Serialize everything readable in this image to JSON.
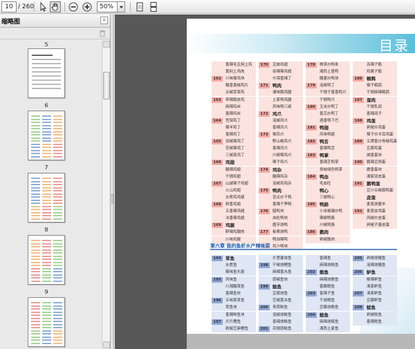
{
  "toolbar": {
    "current_page": "10",
    "total_pages": "/ 260",
    "zoom": "50%",
    "icons": [
      "select-arrow-icon",
      "hand-tool-icon",
      "zoom-out-icon",
      "zoom-in-icon",
      "single-page-icon",
      "continuous-page-icon"
    ]
  },
  "sidebar": {
    "title": "缩略图",
    "thumbnails": [
      {
        "label": "5",
        "style": "text"
      },
      {
        "label": "6",
        "style": "toc"
      },
      {
        "label": "7",
        "style": "toc"
      },
      {
        "label": "8",
        "style": "toc"
      },
      {
        "label": "9",
        "style": "toc"
      }
    ]
  },
  "document": {
    "page_title": "目录",
    "section_title": "第六章 我的鱼虾水产辣味菜"
  },
  "toc_upper": {
    "col1": [
      {
        "n": "",
        "t": "香辣毛豆焖土鸡",
        "h": false
      },
      {
        "n": "",
        "t": "黄焖土鸡肉",
        "h": false
      },
      {
        "n": "162",
        "t": "川味辣鸡块",
        "h": false
      },
      {
        "n": "",
        "t": "酸香黄椒鸡片",
        "h": false
      },
      {
        "n": "",
        "t": "尖椒芽菜鸡",
        "h": false
      },
      {
        "n": "163",
        "t": "带辣鹅皮鸡",
        "h": false
      },
      {
        "n": "",
        "t": "麻辣鸡丝",
        "h": false
      },
      {
        "n": "",
        "t": "香辣鸡丝",
        "h": false
      },
      {
        "n": "164",
        "t": "宫保鸡丁",
        "h": false
      },
      {
        "n": "",
        "t": "辣羊鸡丁",
        "h": false
      },
      {
        "n": "",
        "t": "香辣鸡丁",
        "h": false
      },
      {
        "n": "165",
        "t": "双椒辣鸡丁",
        "h": false
      },
      {
        "n": "",
        "t": "花椒辣鸡丁",
        "h": false
      },
      {
        "n": "",
        "t": "三椒蒸鸡丁",
        "h": false
      },
      {
        "n": "166",
        "t": "鸡翅",
        "h": true
      },
      {
        "n": "",
        "t": "酸辣鸡翅",
        "h": false
      },
      {
        "n": "",
        "t": "干锅鸡翅",
        "h": false
      },
      {
        "n": "167",
        "t": "山城辣子鸡翅",
        "h": false
      },
      {
        "n": "",
        "t": "火山鸡翅",
        "h": false
      },
      {
        "n": "",
        "t": "水煮鸡鸡翅",
        "h": false
      },
      {
        "n": "168",
        "t": "剁香鸡翅",
        "h": false
      },
      {
        "n": "",
        "t": "五香辣鸡翅",
        "h": false
      },
      {
        "n": "",
        "t": "冰香辣鸡翅",
        "h": false
      },
      {
        "n": "169",
        "t": "鸡腿",
        "h": true
      },
      {
        "n": "",
        "t": "醉辣鸡腿肉",
        "h": false
      },
      {
        "n": "",
        "t": "川味鸡腿",
        "h": false
      }
    ],
    "col2": [
      {
        "n": "170",
        "t": "豆豉鸡翅",
        "h": false
      },
      {
        "n": "",
        "t": "劲辣辣鸡翅",
        "h": false
      },
      {
        "n": "",
        "t": "什锦香辣丁",
        "h": false
      },
      {
        "n": "171",
        "t": "鸭肉",
        "h": true
      },
      {
        "n": "",
        "t": "湘味鹅鸡腿",
        "h": false
      },
      {
        "n": "",
        "t": "土家鸭鸡腿",
        "h": false
      },
      {
        "n": "",
        "t": "风味鸭三碗",
        "h": false
      },
      {
        "n": "172",
        "t": "鸡爪",
        "h": true
      },
      {
        "n": "",
        "t": "泡椒凤爪",
        "h": false
      },
      {
        "n": "",
        "t": "香辣凤爪",
        "h": false
      },
      {
        "n": "173",
        "t": "辣凤爪",
        "h": false
      },
      {
        "n": "",
        "t": "野山椒凤爪",
        "h": false
      },
      {
        "n": "",
        "t": "香辣凤爪",
        "h": false
      },
      {
        "n": "",
        "t": "川椒辣鸡爪",
        "h": false
      },
      {
        "n": "",
        "t": "辣子鸡爪",
        "h": false
      },
      {
        "n": "174",
        "t": "鸡杂",
        "h": true
      },
      {
        "n": "",
        "t": "酸辣鸡杂",
        "h": false
      },
      {
        "n": "",
        "t": "泡椒鸡鸡杂",
        "h": false
      },
      {
        "n": "175",
        "t": "鸭肉",
        "h": true
      },
      {
        "n": "",
        "t": "苦瓜炒干鸭",
        "h": false
      },
      {
        "n": "",
        "t": "香辣干笋鸭",
        "h": false
      },
      {
        "n": "176",
        "t": "腊鸭块",
        "h": false
      },
      {
        "n": "",
        "t": "血粒鸭块",
        "h": false
      },
      {
        "n": "",
        "t": "魔芋烧鸭",
        "h": false
      },
      {
        "n": "177",
        "t": "板栗烧鸭",
        "h": false
      },
      {
        "n": "",
        "t": "鸭油辣鸭",
        "h": false
      },
      {
        "n": "",
        "t": "鸡汁鸭块",
        "h": false
      }
    ],
    "col3": [
      {
        "n": "178",
        "t": "樟茶炒鸭条",
        "h": false
      },
      {
        "n": "",
        "t": "湘西土匪鸭",
        "h": false
      },
      {
        "n": "",
        "t": "酸姜炒鸭块",
        "h": false
      },
      {
        "n": "179",
        "t": "泡椒鸭丁",
        "h": false
      },
      {
        "n": "",
        "t": "干锅子香香鸭爪",
        "h": false
      },
      {
        "n": "",
        "t": "干锅鸭爪",
        "h": false
      },
      {
        "n": "180",
        "t": "玉米炒鸭丁",
        "h": false
      },
      {
        "n": "",
        "t": "香芯炒鸭丁",
        "h": false
      },
      {
        "n": "",
        "t": "酒香鸭下巴",
        "h": false
      },
      {
        "n": "181",
        "t": "鸭翅",
        "h": true
      },
      {
        "n": "",
        "t": "风味鸭翅",
        "h": false
      },
      {
        "n": "182",
        "t": "鸭舌",
        "h": true
      },
      {
        "n": "",
        "t": "香辣鸭舌",
        "h": false
      },
      {
        "n": "183",
        "t": "鸭掌",
        "h": true
      },
      {
        "n": "",
        "t": "香辣芝鸭掌",
        "h": false
      },
      {
        "n": "",
        "t": "青蛙绿色鸭掌",
        "h": false
      },
      {
        "n": "184",
        "t": "鸭血",
        "h": true
      },
      {
        "n": "",
        "t": "毛血旺",
        "h": false
      },
      {
        "n": "",
        "t": "鸭心",
        "h": true
      },
      {
        "n": "",
        "t": "三椒鸭心",
        "h": false
      },
      {
        "n": "185",
        "t": "鸭肠",
        "h": true
      },
      {
        "n": "",
        "t": "小米椒爆炒鸭",
        "h": false
      },
      {
        "n": "",
        "t": "辣椒鸭肠",
        "h": false
      },
      {
        "n": "",
        "t": "川椒鸭肠",
        "h": false
      },
      {
        "n": "186",
        "t": "鹅肉",
        "h": true
      },
      {
        "n": "",
        "t": "剁椒鹅肉",
        "h": false
      }
    ],
    "col4": [
      {
        "n": "",
        "t": "苏辣子鹅",
        "h": false
      },
      {
        "n": "",
        "t": "鸡翼子鹅",
        "h": false
      },
      {
        "n": "186",
        "t": "鹌鹑",
        "h": true
      },
      {
        "n": "",
        "t": "辣子鹌鹑",
        "h": false
      },
      {
        "n": "",
        "t": "干焗麻辣鹌鹑",
        "h": false
      },
      {
        "n": "187",
        "t": "蛋肉",
        "h": true
      },
      {
        "n": "",
        "t": "干锅乳鸽",
        "h": false
      },
      {
        "n": "",
        "t": "香辣鸽子",
        "h": false
      },
      {
        "n": "188",
        "t": "鸡蛋",
        "h": true
      },
      {
        "n": "",
        "t": "剁椒炒鸡蛋",
        "h": false
      },
      {
        "n": "",
        "t": "辣子炒木耳鸡蛋",
        "h": false
      },
      {
        "n": "189",
        "t": "五牌香炒青椒鸡蛋",
        "h": false
      },
      {
        "n": "",
        "t": "豆腐鸡蛋",
        "h": false
      },
      {
        "n": "",
        "t": "城香蛋块",
        "h": false
      },
      {
        "n": "190",
        "t": "鹅辣豆饧蛋",
        "h": false
      },
      {
        "n": "",
        "t": "鹿香蛋块",
        "h": false
      },
      {
        "n": "",
        "t": "湘家双皮蛋",
        "h": false
      },
      {
        "n": "191",
        "t": "鹅鸭蛋",
        "h": true
      },
      {
        "n": "",
        "t": "豆汁尖椒鹅鸭蛋",
        "h": false
      },
      {
        "n": "",
        "t": "皮蛋",
        "h": true
      },
      {
        "n": "",
        "t": "麦蒸烧魔羊",
        "h": false
      },
      {
        "n": "192",
        "t": "麦蒸皮鸡蛋",
        "h": false
      },
      {
        "n": "",
        "t": "风椒炒皮蛋",
        "h": false
      },
      {
        "n": "",
        "t": "剁椒子姜皮蛋",
        "h": false
      }
    ]
  },
  "toc_lower": {
    "col1": [
      {
        "n": "194",
        "t": "草鱼",
        "h": true
      },
      {
        "n": "",
        "t": "水煮鱼",
        "h": false
      },
      {
        "n": "",
        "t": "辣味鱼头尾",
        "h": false
      },
      {
        "n": "195",
        "t": "风味鱼",
        "h": false
      },
      {
        "n": "",
        "t": "川湘酸菜鱼",
        "h": false
      },
      {
        "n": "",
        "t": "香辣鱼块",
        "h": false
      },
      {
        "n": "196",
        "t": "五味蒸草鱼",
        "h": false
      },
      {
        "n": "",
        "t": "草鱼块",
        "h": false
      },
      {
        "n": "",
        "t": "香辣鲜鱼块",
        "h": false
      },
      {
        "n": "197",
        "t": "片片鲤鱼",
        "h": false
      },
      {
        "n": "",
        "t": "剁椒芝麻鲤鱼",
        "h": false
      }
    ],
    "col2": [
      {
        "n": "",
        "t": "片里姜烧鱼",
        "h": false
      },
      {
        "n": "198",
        "t": "干椒烧鲤鱼",
        "h": false
      },
      {
        "n": "",
        "t": "麻辣香水鱼",
        "h": false
      },
      {
        "n": "",
        "t": "蒜椒鱼块",
        "h": false
      },
      {
        "n": "199",
        "t": "鲶鱼",
        "h": true
      },
      {
        "n": "",
        "t": "豆腐烧鱼",
        "h": false
      },
      {
        "n": "",
        "t": "芝椒黄冰鱼",
        "h": false
      },
      {
        "n": "200",
        "t": "青蒜鲶鱼",
        "h": false
      },
      {
        "n": "",
        "t": "泡椒烧鲶鱼",
        "h": false
      },
      {
        "n": "",
        "t": "香辣烧鲶鱼",
        "h": false
      },
      {
        "n": "201",
        "t": "吊锅蒜鲶鱼",
        "h": false
      }
    ],
    "col3": [
      {
        "n": "",
        "t": "香辣鱼",
        "h": false
      },
      {
        "n": "",
        "t": "麻辣烧鲶鱼",
        "h": false
      },
      {
        "n": "202",
        "t": "鲍鱼",
        "h": true
      },
      {
        "n": "",
        "t": "麻辣烧鲍鱼",
        "h": false
      },
      {
        "n": "",
        "t": "香酸鲍鱼",
        "h": false
      },
      {
        "n": "203",
        "t": "香辣子鱼",
        "h": false
      },
      {
        "n": "",
        "t": "干烧鲍鱼",
        "h": false
      },
      {
        "n": "",
        "t": "豆瓣烧鲍鱼",
        "h": false
      },
      {
        "n": "204",
        "t": "鲢鱼",
        "h": true
      },
      {
        "n": "",
        "t": "麻辣烧鲢鱼",
        "h": false
      },
      {
        "n": "",
        "t": "湘西土家鱼",
        "h": false
      }
    ],
    "col4": [
      {
        "n": "205",
        "t": "剁椒烧鳝鱼",
        "h": false
      },
      {
        "n": "",
        "t": "泡辣烧鳝鱼",
        "h": false
      },
      {
        "n": "206",
        "t": "鲈鱼",
        "h": true
      },
      {
        "n": "",
        "t": "椒辣鲈鱼",
        "h": false
      },
      {
        "n": "",
        "t": "清蒸鲈鱼",
        "h": false
      },
      {
        "n": "207",
        "t": "清蒸鲈鱼",
        "h": false
      },
      {
        "n": "",
        "t": "豆瓣鲈鱼",
        "h": false
      },
      {
        "n": "208",
        "t": "鱿鱼",
        "h": true
      },
      {
        "n": "",
        "t": "剁椒鱿鱼",
        "h": false
      },
      {
        "n": "",
        "t": "香辣鱿鱼",
        "h": false
      }
    ]
  },
  "colors": {
    "upper_num_bg": "#f4a9a3",
    "upper_row_bg": "#fbe3df",
    "lower_num_bg": "#8fa8d4",
    "lower_row_bg": "#dfe6f4",
    "section_color": "#1d5aa7"
  }
}
